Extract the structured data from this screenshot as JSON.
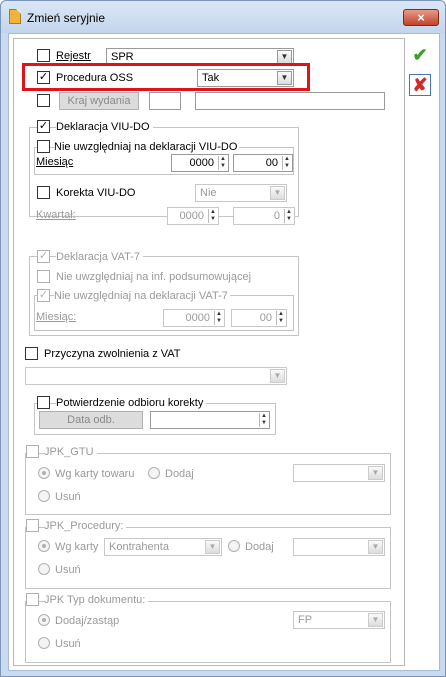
{
  "window": {
    "title": "Zmień seryjnie",
    "close_icon": "×"
  },
  "rejestr": {
    "label": "Rejestr",
    "value": "SPR"
  },
  "oss": {
    "label": "Procedura OSS",
    "value": "Tak"
  },
  "kraj": {
    "button": "Kraj wydania",
    "code": "",
    "name": ""
  },
  "viudo": {
    "label": "Deklaracja VIU-DO",
    "nie_uwzgledniaj": "Nie uwzględniaj na deklaracji VIU-DO",
    "miesiac_label": "Miesiąc",
    "year": "0000",
    "month": "00",
    "korekta_label": "Korekta VIU-DO",
    "korekta_value": "Nie",
    "kwartal_label": "Kwartał:",
    "kw_year": "0000",
    "kw_q": "0"
  },
  "vat7": {
    "label": "Deklaracja VAT-7",
    "nie_podsum": "Nie uwzględniaj na inf. podsumowującej",
    "nie_dekl": "Nie uwzględniaj na deklaracji VAT-7",
    "miesiac_label": "Miesiąc:",
    "year": "0000",
    "month": "00"
  },
  "zwolnienie": {
    "label": "Przyczyna zwolnienia z VAT",
    "value": ""
  },
  "potwierdzenie": {
    "label": "Potwierdzenie odbioru korekty",
    "button": "Data odb.",
    "value": ""
  },
  "jpk_gtu": {
    "label": "JPK_GTU",
    "opt1": "Wg karty towaru",
    "opt2": "Dodaj",
    "opt3": "Usuń",
    "value": ""
  },
  "jpk_proc": {
    "label": "JPK_Procedury:",
    "opt1": "Wg karty",
    "opt1_value": "Kontrahenta",
    "opt2": "Dodaj",
    "opt3": "Usuń",
    "value": ""
  },
  "jpk_typ": {
    "label": "JPK Typ dokumentu:",
    "opt1": "Dodaj/zastąp",
    "opt2": "Usuń",
    "value": "FP"
  },
  "side": {
    "ok_icon": "✔",
    "cancel_icon": "✘"
  },
  "colors": {
    "highlight": "#e0131a",
    "ok": "#3f9e2a",
    "cancel": "#d02a2a"
  }
}
